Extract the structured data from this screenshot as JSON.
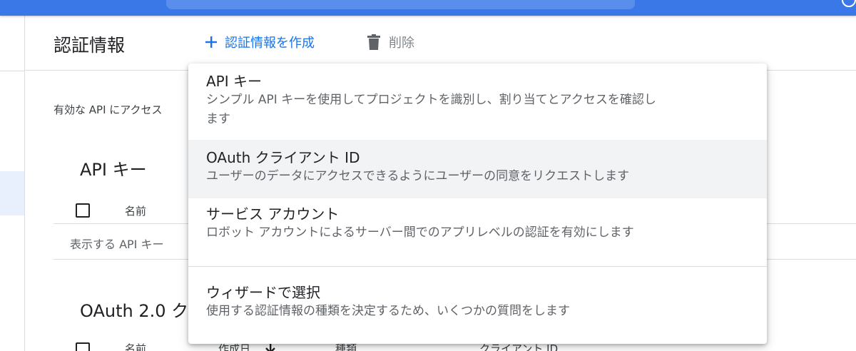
{
  "header": {
    "title": "認証情報",
    "create_label": "認証情報を作成",
    "delete_label": "削除"
  },
  "page": {
    "description": "有効な API にアクセス"
  },
  "api_keys": {
    "section_title": "API キー",
    "col_name": "名前",
    "empty_message": "表示する API キー"
  },
  "oauth": {
    "section_title": "OAuth 2.0 ク",
    "columns": [
      "名前",
      "作成日",
      "種類",
      "クライアント ID"
    ]
  },
  "menu": {
    "items": [
      {
        "title": "API キー",
        "description": "シンプル API キーを使用してプロジェクトを識別し、割り当てとアクセスを確認し\nます"
      },
      {
        "title": "OAuth クライアント ID",
        "description": "ユーザーのデータにアクセスできるようにユーザーの同意をリクエストします"
      },
      {
        "title": "サービス アカウント",
        "description": "ロボット アカウントによるサーバー間でのアプリレベルの認証を有効にします"
      },
      {
        "title": "ウィザードで選択",
        "description": "使用する認証情報の種類を決定するため、いくつかの質問をします"
      }
    ]
  },
  "colors": {
    "topbar": "#3b78e7",
    "accent": "#1a73e8",
    "hover": "#f1f3f4"
  }
}
